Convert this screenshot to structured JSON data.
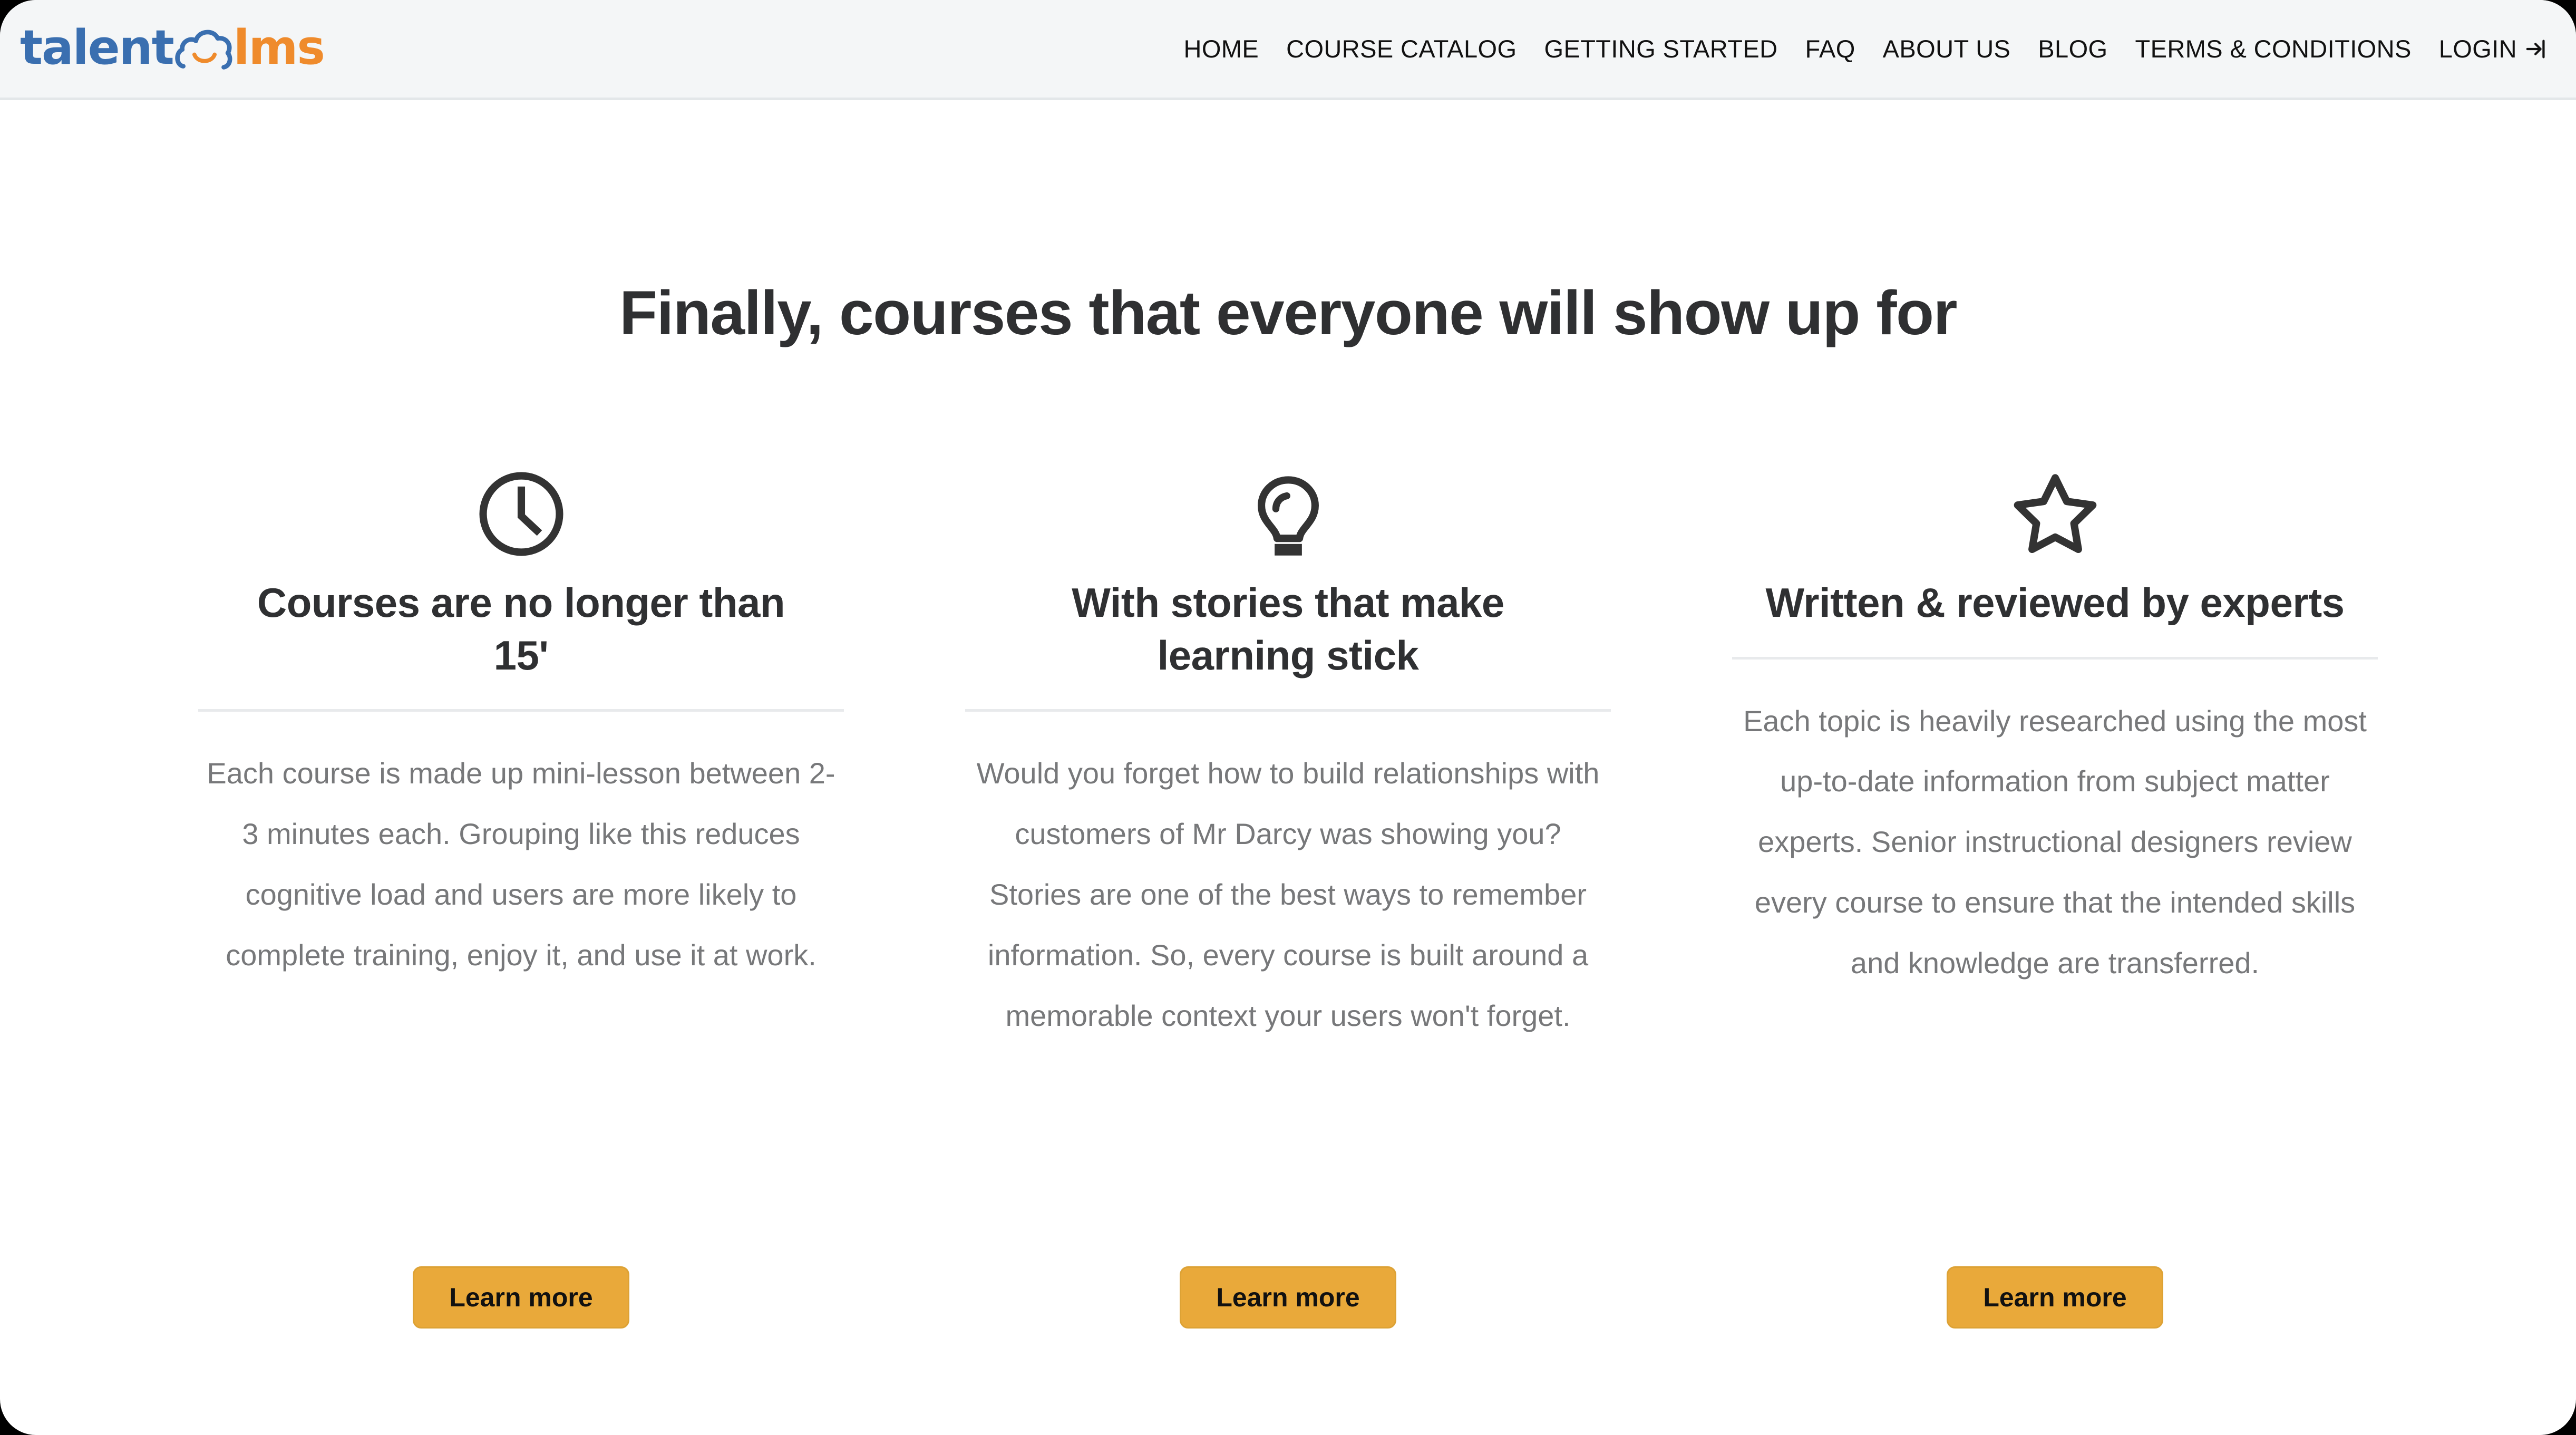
{
  "header": {
    "logo": {
      "text_primary": "talent",
      "text_secondary": "lms",
      "mark_name": "cloud-smiley-icon",
      "color_primary": "#3a6fb0",
      "color_secondary": "#ef8b2c"
    },
    "nav": [
      {
        "label": "HOME"
      },
      {
        "label": "COURSE CATALOG"
      },
      {
        "label": "GETTING STARTED"
      },
      {
        "label": "FAQ"
      },
      {
        "label": "ABOUT US"
      },
      {
        "label": "BLOG"
      },
      {
        "label": "TERMS & CONDITIONS"
      },
      {
        "label": "LOGIN",
        "icon": "login-arrow-icon"
      }
    ],
    "background_color": "#f4f6f7"
  },
  "main": {
    "title": "Finally, courses that everyone will show up for",
    "title_color": "#2f3032",
    "columns": [
      {
        "icon": "clock-icon",
        "title": "Courses are no longer than 15'",
        "text": "Each course is made up mini-lesson between 2-3 minutes each. Grouping like this reduces cognitive load and users are more likely to complete training, enjoy it, and use it at work.",
        "cta_label": "Learn more"
      },
      {
        "icon": "lightbulb-icon",
        "title": "With stories that make learning stick",
        "text": "Would you forget how to build relationships with customers of Mr Darcy was showing you? Stories are one of the best ways to remember information. So, every course is built around a memorable context your users won't forget.",
        "cta_label": "Learn more"
      },
      {
        "icon": "star-icon",
        "title": "Written & reviewed by experts",
        "text": "Each topic is heavily researched using the most up-to-date information from subject matter experts. Senior instructional designers review every course to ensure that the intended skills and knowledge are transferred.",
        "cta_label": "Learn more"
      }
    ],
    "body_text_color": "#77787a",
    "cta_color": "#e9a93a"
  }
}
